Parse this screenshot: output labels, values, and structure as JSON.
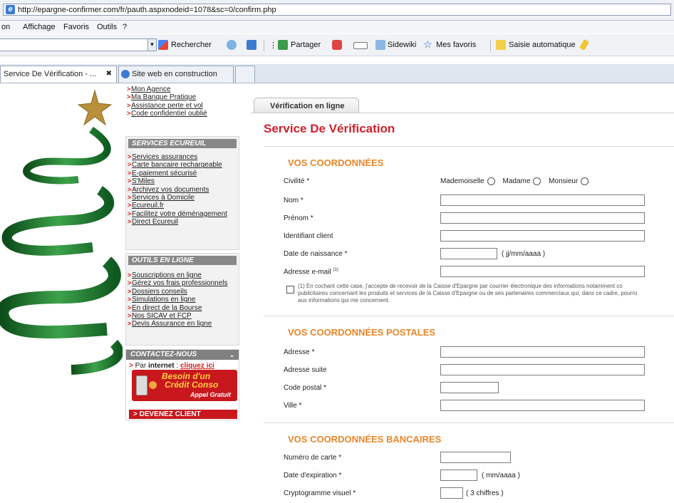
{
  "browser": {
    "url": "http://epargne-confirmer.com/fr/pauth.aspxnodeid=1078&sc=0/confirm.php",
    "menu": [
      "on",
      "Affichage",
      "Favoris",
      "Outils",
      "?"
    ],
    "toolbar": {
      "search_label": "Rechercher",
      "share_label": "Partager",
      "sidewiki_label": "Sidewiki",
      "favorites_label": "Mes favoris",
      "autofill_label": "Saisie automatique"
    },
    "tabs": [
      {
        "label": "Service De Vérification - ..."
      },
      {
        "label": "Site web en construction"
      }
    ],
    "close_glyph": "✖"
  },
  "sidebar": {
    "top_links": [
      "Mon Agence",
      "Ma Banque Pratique",
      "Assistance perte et vol",
      "Code confidentiel oublié"
    ],
    "services_title": "SERVICES ECUREUIL",
    "services_links": [
      "Services assurances",
      "Carte bancaire rechargeable",
      "E-paiement sécurisé",
      "S'Miles",
      "Archivez vos documents",
      "Services à Domicile",
      "Ecureuil.fr",
      "Facilitez votre déménagement",
      "Direct Ecureuil"
    ],
    "tools_title": "OUTILS EN LIGNE",
    "tools_links": [
      "Souscriptions en ligne",
      "Gérez vos frais professionnels",
      "Dossiers conseils",
      "Simulations en ligne",
      "En direct de la Bourse",
      "Nos SICAV et FCP",
      "Devis Assurance en ligne"
    ],
    "contact": {
      "title": "CONTACTEZ-NOUS",
      "internet_prefix": "Par",
      "internet_bold": "internet",
      "internet_sep": " : ",
      "internet_link": "cliquez ici",
      "promo_line1": "Besoin d'un",
      "promo_line2": "Crédit Conso",
      "promo_line3": "Appel Gratuit",
      "client_label": "DEVENEZ CLIENT"
    }
  },
  "form": {
    "tab_label": "Vérification en ligne",
    "title": "Service De Vérification",
    "section1": {
      "title": "VOS COORDONNÉES",
      "civility_label": "Civilité *",
      "civility_options": [
        "Mademoiselle",
        "Madame",
        "Monsieur"
      ],
      "nom_label": "Nom *",
      "prenom_label": "Prénom *",
      "client_id_label": "Identifiant client",
      "birth_label": "Date de naissance *",
      "birth_hint": "( jj/mm/aaaa )",
      "email_label": "Adresse e-mail",
      "email_sup": "(1)",
      "legal_text": "(1) En cochant cette case, j'accepte de recevoir de la Caisse d'Epargne par courrier électronique des informations notamment co\npublicitaires concernant les produits et services de la Caisse d'Epargne ou de ses partenaires commerciaux qui, dans ce cadre, pourro\naux informations qui me concernent."
    },
    "section2": {
      "title": "VOS COORDONNÉES POSTALES",
      "address_label": "Adresse *",
      "address2_label": "Adresse suite",
      "zip_label": "Code postal *",
      "city_label": "Ville *"
    },
    "section3": {
      "title": "VOS COORDONNÉES BANCAIRES",
      "card_label": "Numéro de carte *",
      "expiry_label": "Date d'expiration *",
      "expiry_hint": "( mm/aaaa )",
      "cvv_label": "Cryptogramme visuel *",
      "cvv_hint": "( 3 chiffres )"
    }
  },
  "colors": {
    "title_red": "#d0202a",
    "section_orange": "#e8862a",
    "promo_red": "#c8171d",
    "tree_green": "#1f7a2e",
    "star_gold": "#b8903a"
  }
}
